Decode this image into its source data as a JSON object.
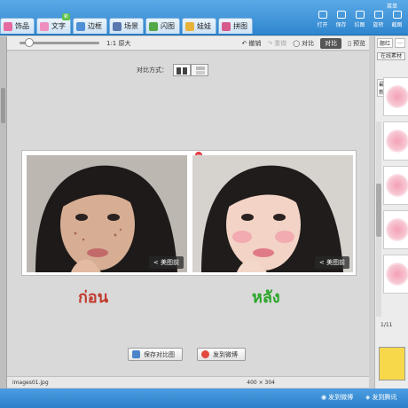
{
  "window": {
    "corner_label": "菜单"
  },
  "tabs": [
    {
      "label": "饰品",
      "color": "#e46aa0"
    },
    {
      "label": "文字",
      "color": "#ef8fbf",
      "badge": "新"
    },
    {
      "label": "边框",
      "color": "#4f8fd6"
    },
    {
      "label": "场景",
      "color": "#5a78b0"
    },
    {
      "label": "闪图",
      "color": "#53a84a"
    },
    {
      "label": "娃娃",
      "color": "#e8b23a"
    },
    {
      "label": "拼图",
      "color": "#d65a8a"
    }
  ],
  "top_buttons": [
    "打开",
    "保存",
    "拉图",
    "旋转",
    "截图"
  ],
  "subbar": {
    "zoom_label": "1:1 原大",
    "undo": "撤销",
    "redo": "重做",
    "compare": "对比",
    "compare_active": "对比",
    "history": "预览"
  },
  "canvas": {
    "compare_mode_label": "对比方式：",
    "photo_tag_before": "< 美图前",
    "photo_tag_after": "< 美图前",
    "close_glyph": "×",
    "caption_before": "ก่อน",
    "caption_after": "หลัง",
    "save_button": "保存对比图",
    "share_button": "发到微博"
  },
  "status": {
    "filename": "images01.jpg",
    "dimensions": "400 × 304"
  },
  "bottom_bar": {
    "share1": "发到微博",
    "share2": "发到腾讯"
  },
  "right_panel": {
    "tabs": [
      "腮红",
      "…"
    ],
    "sub": "在线素材",
    "filters": [
      "最新",
      "热门"
    ],
    "pager": "1/11",
    "brand_color": "#f4a0b5"
  }
}
